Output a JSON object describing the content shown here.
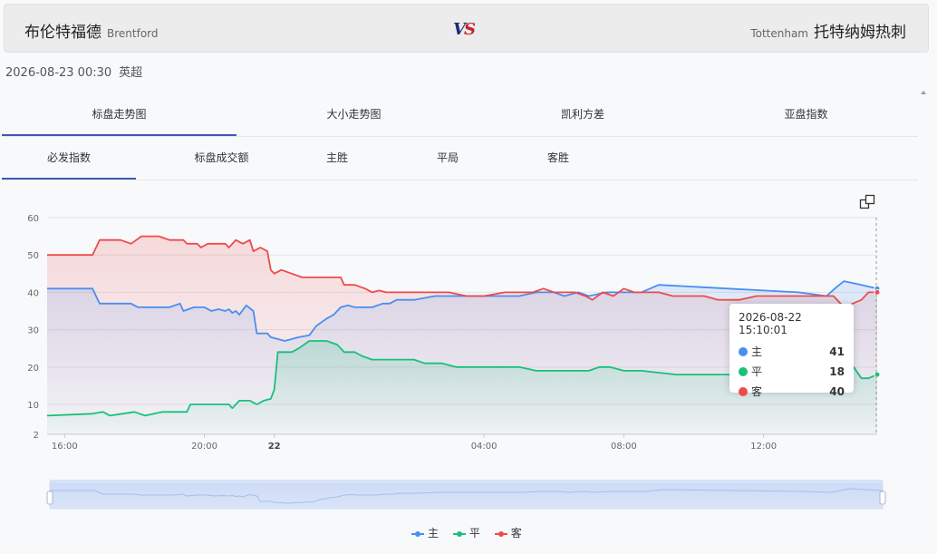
{
  "match": {
    "home_cn": "布伦特福德",
    "home_en": "Brentford",
    "vs_v": "V",
    "vs_s": "S",
    "away_en": "Tottenham",
    "away_cn": "托特纳姆热刺",
    "datetime": "2026-08-23 00:30",
    "league": "英超"
  },
  "tabs_main": [
    {
      "label": "标盘走势图",
      "active": true
    },
    {
      "label": "大小走势图",
      "active": false
    },
    {
      "label": "凯利方差",
      "active": false
    },
    {
      "label": "亚盘指数",
      "active": false
    }
  ],
  "tabs_sub": [
    {
      "label": "必发指数",
      "active": true
    },
    {
      "label": "标盘成交额",
      "active": false
    },
    {
      "label": "主胜",
      "active": false
    },
    {
      "label": "平局",
      "active": false
    },
    {
      "label": "客胜",
      "active": false
    }
  ],
  "colors": {
    "home": "#4a8ef0",
    "draw": "#19c07a",
    "away": "#ee4b4b",
    "accent": "#3d5ab5"
  },
  "tooltip": {
    "time": "2026-08-22 15:10:01",
    "rows": [
      {
        "name": "主",
        "value": "41"
      },
      {
        "name": "平",
        "value": "18"
      },
      {
        "name": "客",
        "value": "40"
      }
    ]
  },
  "chart_data": {
    "type": "line",
    "x_tick_labels": [
      "16:00",
      "20:00",
      "22",
      "04:00",
      "08:00",
      "12:00"
    ],
    "x_tick_hours": [
      16,
      20,
      22,
      28,
      32,
      36
    ],
    "x_start_hour": 15.5,
    "x_end_hour": 39.25,
    "ylim": [
      2,
      60
    ],
    "y_ticks": [
      2,
      10,
      20,
      30,
      40,
      50,
      60
    ],
    "grid": true,
    "legend_position": "bottom",
    "series": [
      {
        "name": "主",
        "color": "#4a8ef0",
        "points": [
          [
            15.5,
            41
          ],
          [
            16.8,
            41
          ],
          [
            17.0,
            37
          ],
          [
            17.9,
            37
          ],
          [
            18.1,
            36
          ],
          [
            19.0,
            36
          ],
          [
            19.3,
            37
          ],
          [
            19.4,
            35
          ],
          [
            19.7,
            36
          ],
          [
            20.0,
            36
          ],
          [
            20.2,
            35
          ],
          [
            20.4,
            35.5
          ],
          [
            20.6,
            35
          ],
          [
            20.7,
            35.5
          ],
          [
            20.8,
            34.5
          ],
          [
            20.9,
            35
          ],
          [
            21.0,
            34
          ],
          [
            21.2,
            36.5
          ],
          [
            21.4,
            35
          ],
          [
            21.5,
            29
          ],
          [
            21.8,
            29
          ],
          [
            21.9,
            28
          ],
          [
            22.3,
            27
          ],
          [
            22.7,
            28
          ],
          [
            23.0,
            28.5
          ],
          [
            23.2,
            31
          ],
          [
            23.5,
            33
          ],
          [
            23.7,
            34
          ],
          [
            23.9,
            36
          ],
          [
            24.1,
            36.5
          ],
          [
            24.3,
            36
          ],
          [
            24.8,
            36
          ],
          [
            25.1,
            37
          ],
          [
            25.3,
            37
          ],
          [
            25.5,
            38
          ],
          [
            26.0,
            38
          ],
          [
            26.3,
            38.5
          ],
          [
            26.6,
            39
          ],
          [
            27.5,
            39
          ],
          [
            28.0,
            39
          ],
          [
            29.0,
            39
          ],
          [
            29.5,
            40
          ],
          [
            30.0,
            40
          ],
          [
            30.3,
            39
          ],
          [
            30.7,
            40
          ],
          [
            31.0,
            39
          ],
          [
            31.5,
            40
          ],
          [
            32.5,
            40
          ],
          [
            33.0,
            42
          ],
          [
            35.0,
            41
          ],
          [
            36.0,
            40.5
          ],
          [
            37.0,
            40
          ],
          [
            37.8,
            39
          ],
          [
            38.1,
            41.5
          ],
          [
            38.3,
            43
          ],
          [
            38.8,
            42
          ],
          [
            39.25,
            41
          ]
        ]
      },
      {
        "name": "平",
        "color": "#19c07a",
        "points": [
          [
            15.5,
            7
          ],
          [
            16.8,
            7.5
          ],
          [
            17.1,
            8
          ],
          [
            17.3,
            7
          ],
          [
            18.0,
            8
          ],
          [
            18.3,
            7
          ],
          [
            18.8,
            8
          ],
          [
            19.5,
            8
          ],
          [
            19.6,
            10
          ],
          [
            20.7,
            10
          ],
          [
            20.8,
            9
          ],
          [
            21.0,
            11
          ],
          [
            21.3,
            11
          ],
          [
            21.5,
            10
          ],
          [
            21.7,
            11
          ],
          [
            21.9,
            11.5
          ],
          [
            22.0,
            14
          ],
          [
            22.1,
            24
          ],
          [
            22.3,
            24
          ],
          [
            22.5,
            24
          ],
          [
            22.7,
            25
          ],
          [
            23.0,
            27
          ],
          [
            23.5,
            27
          ],
          [
            23.8,
            26
          ],
          [
            24.0,
            24
          ],
          [
            24.3,
            24
          ],
          [
            24.5,
            23
          ],
          [
            24.8,
            22
          ],
          [
            25.5,
            22
          ],
          [
            26.0,
            22
          ],
          [
            26.3,
            21
          ],
          [
            26.8,
            21
          ],
          [
            27.2,
            20
          ],
          [
            28.0,
            20
          ],
          [
            29.0,
            20
          ],
          [
            29.5,
            19
          ],
          [
            31.0,
            19
          ],
          [
            31.3,
            20
          ],
          [
            31.6,
            20
          ],
          [
            32.0,
            19
          ],
          [
            32.5,
            19
          ],
          [
            33.5,
            18
          ],
          [
            35.0,
            18
          ],
          [
            37.0,
            19
          ],
          [
            37.5,
            20
          ],
          [
            38.5,
            21
          ],
          [
            38.8,
            17
          ],
          [
            39.0,
            17
          ],
          [
            39.25,
            18
          ]
        ]
      },
      {
        "name": "客",
        "color": "#ee4b4b",
        "points": [
          [
            15.5,
            50
          ],
          [
            16.8,
            50
          ],
          [
            17.0,
            54
          ],
          [
            17.6,
            54
          ],
          [
            17.9,
            53
          ],
          [
            18.2,
            55
          ],
          [
            18.7,
            55
          ],
          [
            19.0,
            54
          ],
          [
            19.4,
            54
          ],
          [
            19.5,
            53
          ],
          [
            19.8,
            53
          ],
          [
            19.9,
            52
          ],
          [
            20.1,
            53
          ],
          [
            20.6,
            53
          ],
          [
            20.7,
            52
          ],
          [
            20.9,
            54
          ],
          [
            21.1,
            53
          ],
          [
            21.3,
            54
          ],
          [
            21.4,
            51
          ],
          [
            21.6,
            52
          ],
          [
            21.8,
            51
          ],
          [
            21.9,
            46
          ],
          [
            22.0,
            45
          ],
          [
            22.2,
            46
          ],
          [
            22.5,
            45
          ],
          [
            22.8,
            44
          ],
          [
            23.0,
            44
          ],
          [
            23.5,
            44
          ],
          [
            23.9,
            44
          ],
          [
            24.0,
            42
          ],
          [
            24.3,
            42
          ],
          [
            24.6,
            41
          ],
          [
            24.8,
            40
          ],
          [
            25.0,
            40.5
          ],
          [
            25.2,
            40
          ],
          [
            25.5,
            40
          ],
          [
            26.0,
            40
          ],
          [
            26.5,
            40
          ],
          [
            27.0,
            40
          ],
          [
            27.5,
            39
          ],
          [
            28.0,
            39
          ],
          [
            28.6,
            40
          ],
          [
            29.0,
            40
          ],
          [
            29.4,
            40
          ],
          [
            29.7,
            41
          ],
          [
            30.0,
            40
          ],
          [
            30.6,
            40
          ],
          [
            30.9,
            39
          ],
          [
            31.1,
            38
          ],
          [
            31.4,
            40
          ],
          [
            31.7,
            39
          ],
          [
            32.0,
            41
          ],
          [
            32.3,
            40
          ],
          [
            33.0,
            40
          ],
          [
            33.4,
            39
          ],
          [
            34.3,
            39
          ],
          [
            34.7,
            38
          ],
          [
            35.3,
            38
          ],
          [
            35.8,
            39
          ],
          [
            36.8,
            39
          ],
          [
            37.0,
            39
          ],
          [
            37.5,
            39
          ],
          [
            38.0,
            39
          ],
          [
            38.3,
            36
          ],
          [
            38.8,
            38
          ],
          [
            39.0,
            40
          ],
          [
            39.25,
            40
          ]
        ]
      }
    ]
  },
  "legend": [
    {
      "label": "主",
      "color": "#4a8ef0"
    },
    {
      "label": "平",
      "color": "#19c07a"
    },
    {
      "label": "客",
      "color": "#ee4b4b"
    }
  ]
}
